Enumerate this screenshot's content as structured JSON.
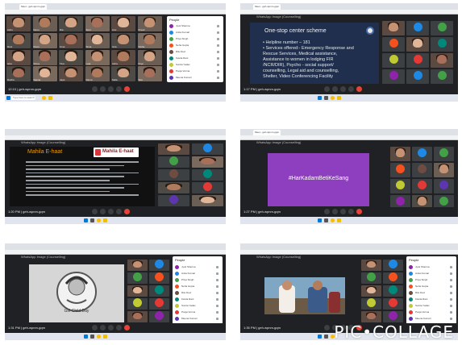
{
  "shot1": {
    "time": "12:10 | geh-wpnm-gqm",
    "tab": "Meet - geh-wpnm-gqm",
    "panel_title": "People",
    "people": [
      "Jyoti Sharma",
      "Anita Kumari",
      "Priya Singh",
      "Neha Gupta",
      "Ritu Devi",
      "Kavita Rani",
      "Sunita Yadav",
      "Pooja Verma",
      "Meena Kumari"
    ],
    "grid_names": [
      "Ashu",
      "Renu",
      "Ria",
      "Soni",
      "Anu",
      "Preeti",
      "Rani",
      "Kiran",
      "Uma",
      "Sima",
      "Gita",
      "Nisha",
      "Isha",
      "Mona",
      "Tina",
      "Lata",
      "Asha",
      "Puja",
      "Rekha",
      "Sapna",
      "Jaya",
      "Rama",
      "Mala",
      "Sita"
    ],
    "search_placeholder": "Type here to search"
  },
  "shot2": {
    "time": "1:17 PM | geh-wpnm-gqm",
    "tab": "Meet - geh-wpnm-gqm",
    "meeting": "WhatsApp Image (Counselling)",
    "slide_title": "One-stop center scheme",
    "bullets": [
      "Helpline number – 181",
      "Services offered:- Emergency Response and",
      "Rescue Services, Medical assistance,",
      "Assistance to women in lodging FIR",
      "/NCR/DIR), Psycho - social support/",
      "counselling, Legal aid and counselling,",
      "Shelter, Video Conferencing Facility"
    ]
  },
  "shot3": {
    "time": "1:20 PM | geh-wpnm-gqm",
    "meeting": "WhatsApp Image (Counselling)",
    "slide_title": "Mahila E-haat",
    "logo_text": "Mahila E-haat"
  },
  "shot4": {
    "time": "1:27 PM | geh-wpnm-gqm",
    "tab": "Meet - geh-wpnm-gqm",
    "meeting": "WhatsApp Image (Counselling)",
    "hashtag": "#HarKadamBetiKeSang"
  },
  "shot5": {
    "time": "1:31 PM | geh-wpnm-gqm",
    "meeting": "WhatsApp Image (Counselling)",
    "panel_title": "People",
    "video_caption": "Girl Child Day"
  },
  "shot6": {
    "time": "1:35 PM | geh-wpnm-gqm",
    "meeting": "WhatsApp Image (Counselling)",
    "panel_title": "People"
  },
  "watermark": "PIC•COLLAGE",
  "colors": {
    "meet_dark": "#202124",
    "tile": "#3c4043",
    "red": "#ea4335",
    "slide_blue": "#1f2f4d",
    "purple": "#8e3fbf",
    "accent_orange": "#f29900"
  }
}
